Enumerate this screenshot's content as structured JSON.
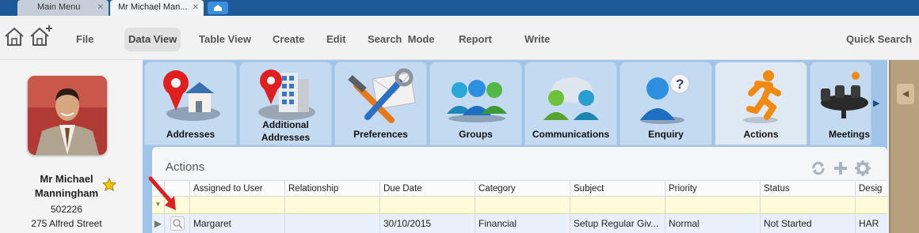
{
  "tabs": [
    {
      "label": "Main Menu",
      "active": false
    },
    {
      "label": "Mr Michael Man...",
      "active": true
    }
  ],
  "tab_close_glyph": "✕",
  "toolbar": {
    "menu": [
      "File",
      "Data View",
      "Table View",
      "Create",
      "Edit",
      "Search  Mode",
      "Report",
      "Write"
    ],
    "active_item": "Data View",
    "quick_search": "Quick Search",
    "icons": [
      "home-icon",
      "add-home-icon"
    ]
  },
  "contact": {
    "name": "Mr Michael Manningham",
    "id": "502226",
    "address": "275 Alfred Street",
    "favourite": true
  },
  "modules": [
    {
      "label": "Addresses",
      "icon": "map-pin-house-icon"
    },
    {
      "label": "Additional Addresses",
      "icon": "map-pin-building-icon"
    },
    {
      "label": "Preferences",
      "icon": "tools-envelope-icon"
    },
    {
      "label": "Groups",
      "icon": "group-people-icon"
    },
    {
      "label": "Communications",
      "icon": "chat-people-icon"
    },
    {
      "label": "Enquiry",
      "icon": "person-question-icon"
    },
    {
      "label": "Actions",
      "icon": "running-man-icon",
      "active": true
    },
    {
      "label": "Meetings",
      "icon": "meeting-table-icon"
    }
  ],
  "panel": {
    "title": "Actions",
    "icons": [
      "refresh-icon",
      "add-icon",
      "settings-icon"
    ]
  },
  "grid": {
    "columns": [
      "Assigned to User",
      "Relationship",
      "Due Date",
      "Category",
      "Subject",
      "Priority",
      "Status",
      "Desig"
    ],
    "rows": [
      [
        "Margaret",
        "",
        "30/10/2015",
        "Financial",
        "Setup Regular Giv...",
        "Normal",
        "Not Started",
        "HAR"
      ]
    ]
  },
  "colors": {
    "tab_strip": "#1f5a98",
    "module_background": "#9fc4e8",
    "filter_row": "#fffbd9",
    "selected_row": "#e8f0fb",
    "annotation_arrow": "#e0201e",
    "star": "#f5c400"
  }
}
